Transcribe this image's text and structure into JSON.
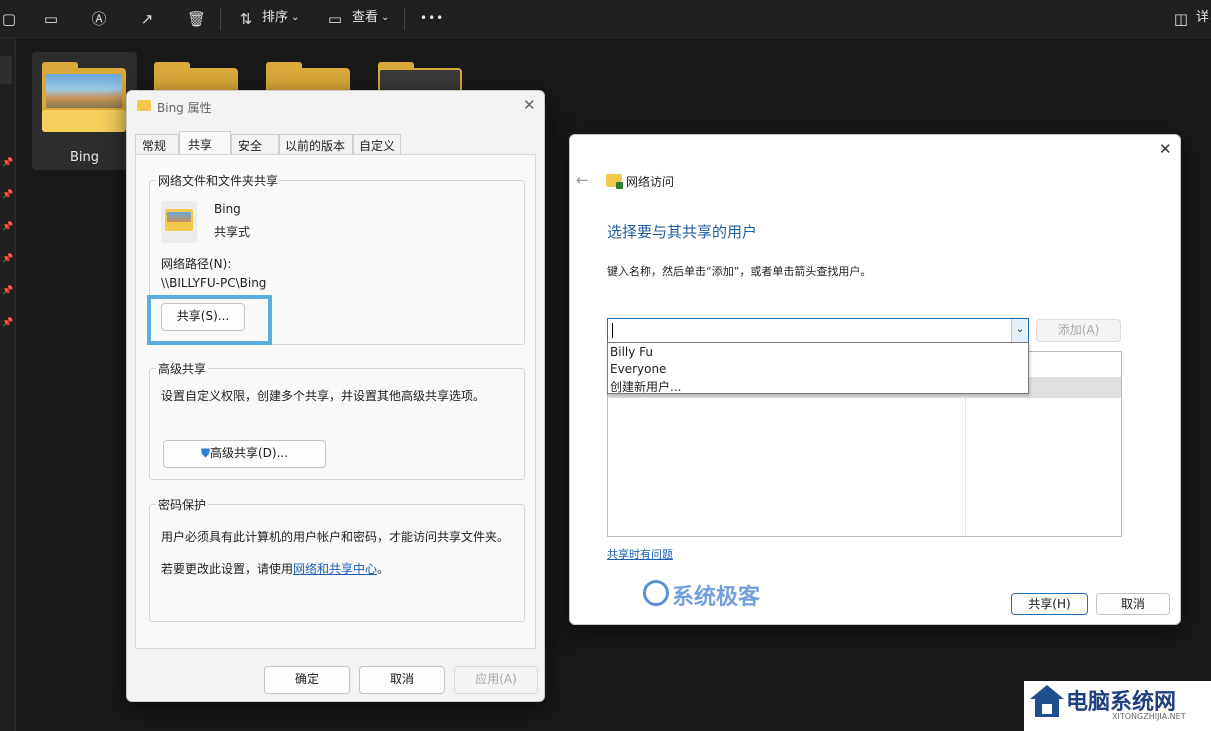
{
  "toolbar": {
    "sort_label": "排序",
    "view_label": "查看",
    "more_label": "•••",
    "details_label": "详"
  },
  "folders": [
    {
      "name": "Bing",
      "selected": true,
      "icon": "folder-with-photo-icon"
    },
    {
      "name": "",
      "selected": false,
      "icon": "folder-icon"
    },
    {
      "name": "",
      "selected": false,
      "icon": "folder-icon"
    },
    {
      "name": "",
      "selected": false,
      "icon": "folder-dark-icon"
    }
  ],
  "properties": {
    "title": "Bing 属性",
    "tabs": [
      "常规",
      "共享",
      "安全",
      "以前的版本",
      "自定义"
    ],
    "active_tab": "共享",
    "section_network": "网络文件和文件夹共享",
    "folder_name": "Bing",
    "folder_status": "共享式",
    "path_label": "网络路径(N):",
    "path_value": "\\\\BILLYFU-PC\\Bing",
    "share_button": "共享(S)...",
    "section_advanced": "高级共享",
    "advanced_desc": "设置自定义权限，创建多个共享，并设置其他高级共享选项。",
    "advanced_button": "高级共享(D)...",
    "section_password": "密码保护",
    "password_desc": "用户必须具有此计算机的用户帐户和密码，才能访问共享文件夹。",
    "password_change_prefix": "若要更改此设置，请使用",
    "password_link": "网络和共享中心",
    "password_suffix": "。",
    "ok_button": "确定",
    "cancel_button": "取消",
    "apply_button": "应用(A)",
    "highlight_color": "#5aaee0"
  },
  "network_access": {
    "title": "网络访问",
    "heading": "选择要与其共享的用户",
    "instruction": "键入名称，然后单击“添加”，或者单击箭头查找用户。",
    "input_value": "",
    "add_button": "添加(A)",
    "dropdown_options": [
      "Billy Fu",
      "Everyone",
      "创建新用户..."
    ],
    "trouble_link": "共享时有问题",
    "share_button": "共享(H)",
    "cancel_button": "取消",
    "accent_color": "#1f5f9e"
  },
  "watermarks": {
    "xitong": "系统极客",
    "site_name": "电脑系统网",
    "site_url": "XITONGZHIJIA.NET"
  }
}
